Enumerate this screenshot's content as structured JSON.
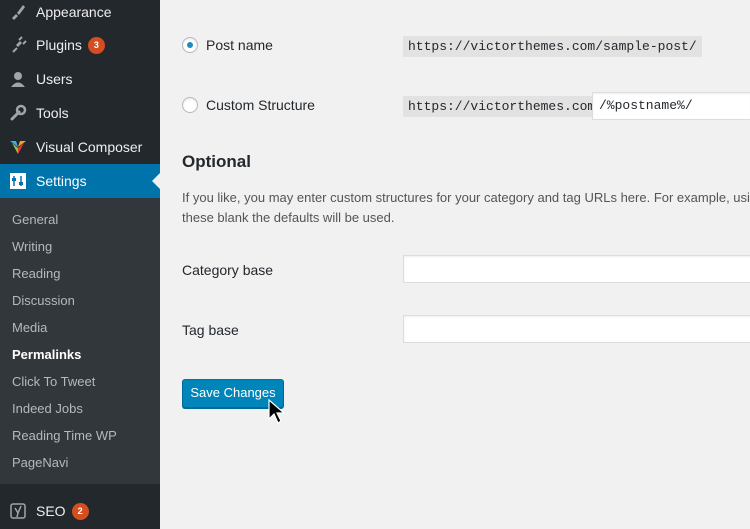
{
  "sidebar": {
    "menu": [
      {
        "label": "Appearance",
        "icon": "paintbrush-icon"
      },
      {
        "label": "Plugins",
        "icon": "plugin-icon",
        "badge": "3"
      },
      {
        "label": "Users",
        "icon": "users-icon"
      },
      {
        "label": "Tools",
        "icon": "wrench-icon"
      },
      {
        "label": "Visual Composer",
        "icon": "visual-composer-icon"
      },
      {
        "label": "Settings",
        "icon": "settings-icon",
        "active": true
      }
    ],
    "submenu": [
      "General",
      "Writing",
      "Reading",
      "Discussion",
      "Media",
      "Permalinks",
      "Click To Tweet",
      "Indeed Jobs",
      "Reading Time WP",
      "PageNavi"
    ],
    "submenu_current": "Permalinks",
    "seo": {
      "label": "SEO",
      "icon": "yoast-icon",
      "badge": "2"
    }
  },
  "permalinks": {
    "post_name": {
      "label": "Post name",
      "example": "https://victorthemes.com/sample-post/",
      "checked": true
    },
    "custom": {
      "label": "Custom Structure",
      "prefix": "https://victorthemes.com",
      "value": "/%postname%/",
      "checked": false
    }
  },
  "optional": {
    "heading": "Optional",
    "description_line1": "If you like, you may enter custom structures for your category and tag URLs here. For example, usin",
    "description_line2": "these blank the defaults will be used.",
    "category_base_label": "Category base",
    "category_base_value": "",
    "tag_base_label": "Tag base",
    "tag_base_value": ""
  },
  "actions": {
    "save_label": "Save Changes"
  },
  "colors": {
    "sidebar_bg": "#23282d",
    "submenu_bg": "#32373c",
    "accent": "#0073aa",
    "badge": "#d54e21",
    "button": "#0085ba"
  }
}
